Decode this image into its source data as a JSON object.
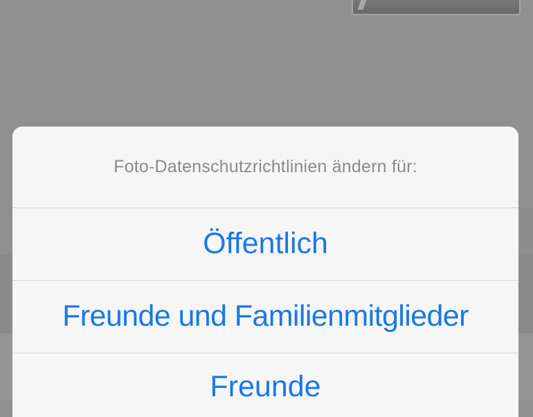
{
  "action_sheet": {
    "title": "Foto-Datenschutzrichtlinien ändern für:",
    "options": [
      {
        "label": "Öffentlich"
      },
      {
        "label": "Freunde und Familienmitglieder"
      },
      {
        "label": "Freunde"
      }
    ]
  },
  "colors": {
    "overlay": "#909090",
    "sheet_background": "#f6f6f6",
    "title_text": "#8a8a8a",
    "option_text": "#1a78e6",
    "separator": "#d4d4d4"
  }
}
